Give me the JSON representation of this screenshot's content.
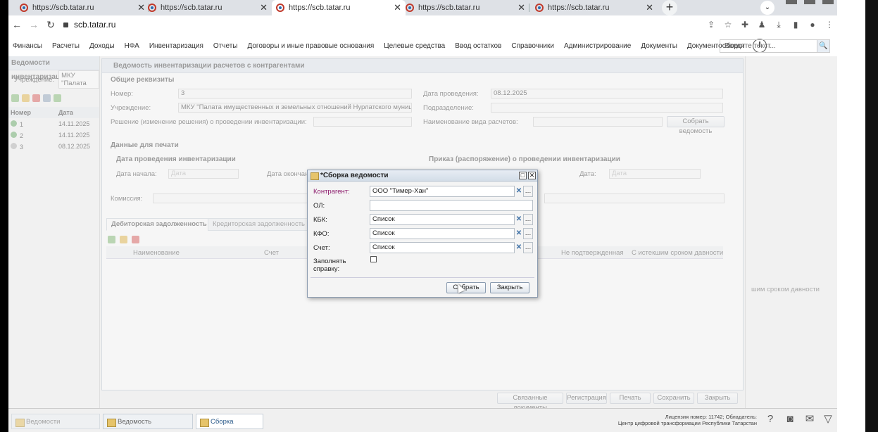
{
  "browser": {
    "tabs": [
      {
        "title": "https://scb.tatar.ru",
        "active": false
      },
      {
        "title": "https://scb.tatar.ru",
        "active": false
      },
      {
        "title": "https://scb.tatar.ru",
        "active": true
      },
      {
        "title": "https://scb.tatar.ru",
        "active": false
      },
      {
        "title": "https://scb.tatar.ru",
        "active": false
      }
    ],
    "url": "scb.tatar.ru"
  },
  "menu": {
    "items": [
      "Финансы",
      "Расчеты",
      "Доходы",
      "НФА",
      "Инвентаризация",
      "Отчеты",
      "Договоры и иные правовые основания",
      "Целевые средства",
      "Ввод остатков",
      "Справочники",
      "Администрирование",
      "Документы",
      "Документооборот"
    ],
    "search_placeholder": "Введите текст..."
  },
  "left_panel": {
    "title": "Ведомости инвентаризац",
    "filter_label": "Учреждение:",
    "filter_value": "МКУ \"Палата",
    "col_number": "Номер",
    "col_date": "Дата",
    "rows": [
      {
        "number": "1",
        "date": "14.11.2025"
      },
      {
        "number": "2",
        "date": "14.11.2025"
      },
      {
        "number": "3",
        "date": "08.12.2025"
      }
    ]
  },
  "form": {
    "title": "Ведомость инвентаризации расчетов с контрагентами",
    "section_general": "Общие реквизиты",
    "number_label": "Номер:",
    "number_value": "3",
    "institution_label": "Учреждение:",
    "institution_value": "МКУ \"Палата имущественных и земельных отношений Нурлатского муницип",
    "decision_label": "Решение (изменение решения) о проведении инвентаризации:",
    "date_label": "Дата проведения:",
    "date_value": "08.12.2025",
    "division_label": "Подразделение:",
    "calc_type_label": "Наименование вида расчетов:",
    "build_button": "Собрать ведомость",
    "section_print": "Данные для печати",
    "inv_dates_title": "Дата проведения инвентаризации",
    "start_label": "Дата начала:",
    "start_placeholder": "Дата",
    "end_label": "Дата окончан",
    "order_title": "Приказ (распоряжение) о проведении инвентаризации",
    "order_date_label": "Дата:",
    "order_date_placeholder": "Дата",
    "commission_label": "Комиссия:",
    "tabs": [
      "Дебиторская задолженность",
      "Кредиторская задолженность"
    ],
    "columns": [
      "Наименование",
      "Счет",
      "Не подтвержденная",
      "С истекшим сроком давности"
    ],
    "footer_buttons": [
      "Связанные документы",
      "Регистрация",
      "Печать",
      "Сохранить",
      "Закрыть"
    ]
  },
  "right_panel": {
    "col_text": "шим сроком давности"
  },
  "modal": {
    "title": "*Сборка ведомости",
    "fields": [
      {
        "label": "Контрагент:",
        "value": "ООО \"Тимер-Хан\""
      },
      {
        "label": "ОЛ:",
        "value": ""
      },
      {
        "label": "КБК:",
        "value": "Список"
      },
      {
        "label": "КФО:",
        "value": "Список"
      },
      {
        "label": "Счет:",
        "value": "Список"
      }
    ],
    "checkbox_label": "Заполнять справку:",
    "ok_button": "Собрать",
    "close_button": "Закрыть"
  },
  "taskbar": {
    "items": [
      "Ведомости инвентаризац",
      "Ведомость инвентаризац",
      "Сборка ведомости"
    ],
    "license": "Лицензия номер: 11742; Обладатель:",
    "owner": "Центр цифровой трансформации Республики Татарстан"
  }
}
